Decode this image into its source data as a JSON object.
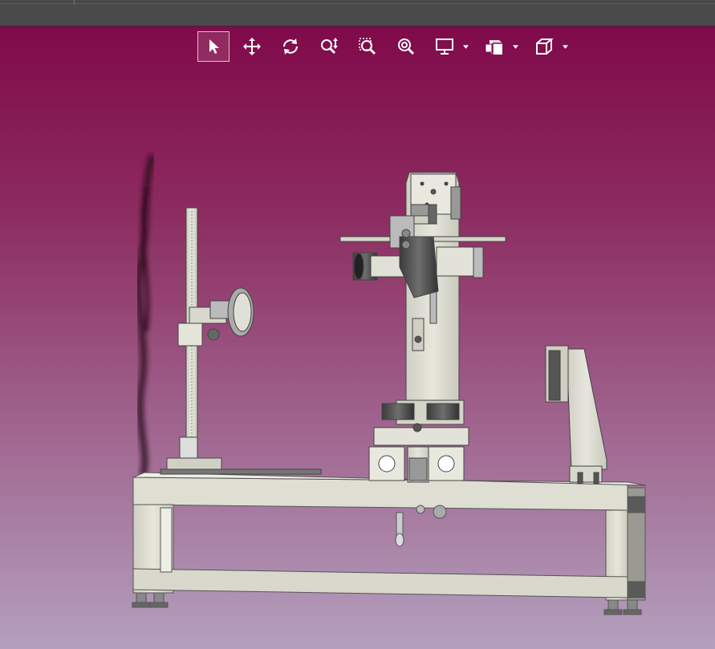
{
  "window": {
    "title_bar_color": "#4a4a4a"
  },
  "viewport": {
    "background_top": "#800a4a",
    "background_bottom": "#b4a0be",
    "model": "machine-assembly"
  },
  "toolbar": {
    "items": [
      {
        "id": "select",
        "icon": "cursor-arrow-icon",
        "active": true
      },
      {
        "id": "pan",
        "icon": "move-arrows-icon",
        "active": false
      },
      {
        "id": "rotate",
        "icon": "rotate-icon",
        "active": false
      },
      {
        "id": "zoom",
        "icon": "zoom-updown-icon",
        "active": false
      },
      {
        "id": "zoom-window",
        "icon": "zoom-window-icon",
        "active": false
      },
      {
        "id": "zoom-fit",
        "icon": "zoom-fit-icon",
        "active": false
      },
      {
        "id": "display",
        "icon": "monitor-icon",
        "active": false,
        "dropdown": true
      },
      {
        "id": "render-style",
        "icon": "shaded-cube-icon",
        "active": false,
        "dropdown": true
      },
      {
        "id": "view-orientation",
        "icon": "wire-cube-icon",
        "active": false,
        "dropdown": true
      }
    ]
  }
}
